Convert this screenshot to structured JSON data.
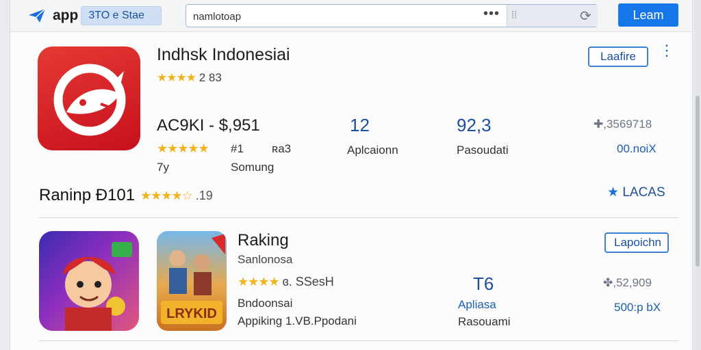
{
  "header": {
    "logo_text": "app",
    "logo_badge": "3TO e Stae",
    "search_value": "namlotoap",
    "search_dots": "•••",
    "search_grip": "⁞⁞",
    "refresh_icon": "⟳",
    "login_label": "Leam"
  },
  "featured": {
    "title": "Indhsk Indonesiai",
    "stars": "★★★★",
    "rating_text": "2 83",
    "price": "AC9KI - $,951",
    "row_stars": "★★★★★",
    "meta_a": "#1",
    "meta_b": "ʀa3",
    "age": "7y",
    "developer": "Somung",
    "stat1_value": "12",
    "stat1_label": "Aplcaionn",
    "stat2_value": "92,3",
    "stat2_label": "Pasoudati",
    "side_value": "✚,3569718",
    "side_link": "00.noiX",
    "action_label": "Laafire",
    "kebab": "⋮"
  },
  "section": {
    "title": "Raninp Ð101",
    "stars": "★★★★☆",
    "rating_text": ".19",
    "link_label": "LACAS"
  },
  "app2": {
    "title": "Raking",
    "subtitle": "Sanlonosa",
    "stars": "★★★★",
    "rating_text": "ɞ. SSesH",
    "meta_a": "Bndoonsai",
    "meta_b": "Appiking  1.VB.Ppodani",
    "game_label": "LRYKID",
    "stat_value": "T6",
    "stat_label": "Apliasa",
    "stat_label2": "Rasouami",
    "side_value": "✤,52,909",
    "side_link": "500:p bX",
    "action_label": "Lapoichn"
  },
  "colors": {
    "accent": "#1677ea",
    "star": "#f1b21b",
    "app_icon_red": "#d8202a"
  }
}
